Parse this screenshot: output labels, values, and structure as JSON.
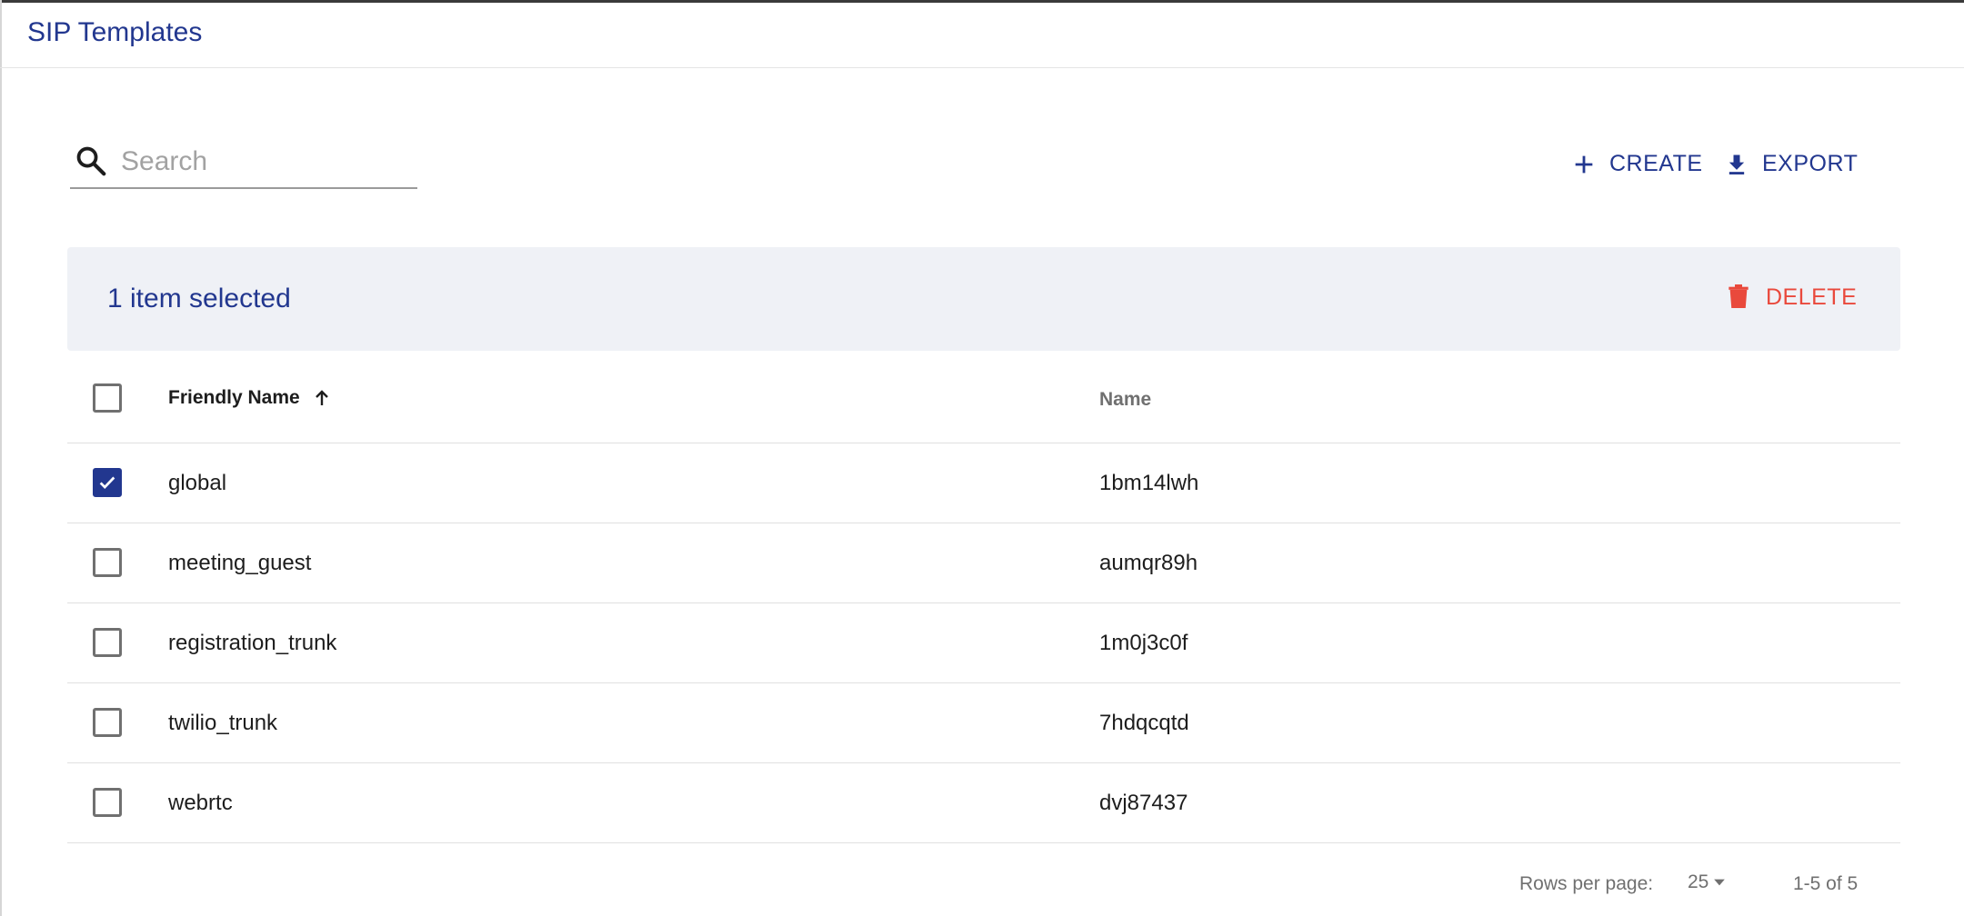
{
  "header": {
    "title": "SIP Templates"
  },
  "search": {
    "placeholder": "Search",
    "value": ""
  },
  "toolbar": {
    "create_label": "CREATE",
    "export_label": "EXPORT"
  },
  "selection": {
    "count_text": "1 item selected",
    "delete_label": "DELETE"
  },
  "table": {
    "columns": {
      "friendly_name": "Friendly Name",
      "name": "Name"
    },
    "rows": [
      {
        "friendly_name": "global",
        "name": "1bm14lwh",
        "checked": true
      },
      {
        "friendly_name": "meeting_guest",
        "name": "aumqr89h",
        "checked": false
      },
      {
        "friendly_name": "registration_trunk",
        "name": "1m0j3c0f",
        "checked": false
      },
      {
        "friendly_name": "twilio_trunk",
        "name": "7hdqcqtd",
        "checked": false
      },
      {
        "friendly_name": "webrtc",
        "name": "dvj87437",
        "checked": false
      }
    ]
  },
  "pagination": {
    "rows_per_page_label": "Rows per page:",
    "rows_per_page": "25",
    "range": "1-5 of 5"
  },
  "colors": {
    "accent": "#22378f",
    "danger": "#e9493c",
    "selbar": "#eff1f6"
  }
}
